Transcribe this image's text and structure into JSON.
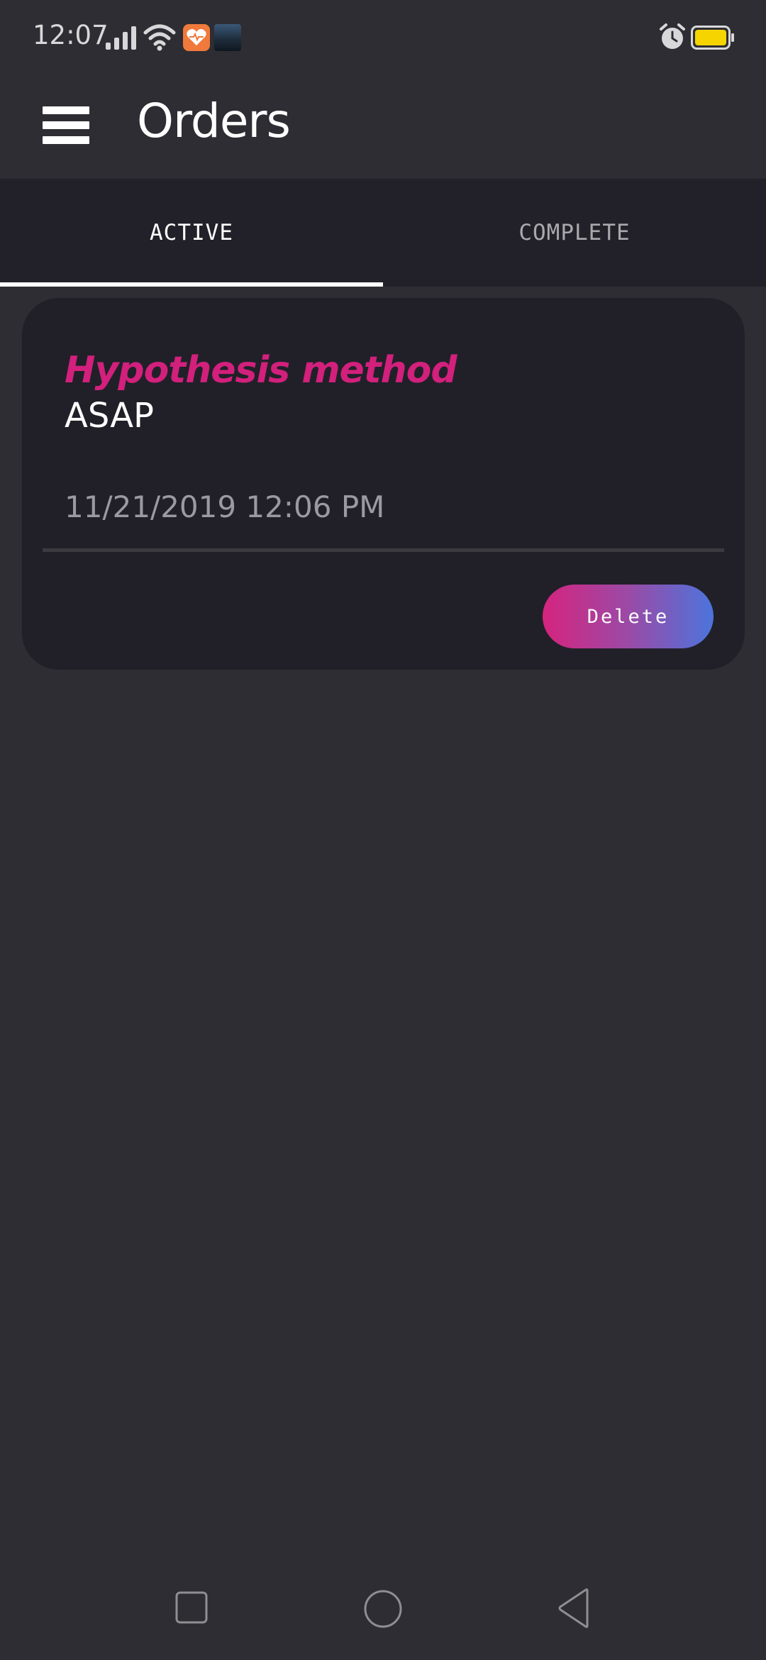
{
  "status_bar": {
    "time": "12:07",
    "icons": [
      "signal-icon",
      "wifi-icon",
      "health-app-icon",
      "photo-app-icon",
      "alarm-icon",
      "battery-icon"
    ],
    "battery_color": "#f5d400"
  },
  "app_bar": {
    "title": "Orders",
    "menu_icon": "hamburger-menu-icon"
  },
  "tabs": [
    {
      "label": "ACTIVE",
      "selected": true
    },
    {
      "label": "COMPLETE",
      "selected": false
    }
  ],
  "orders": [
    {
      "name": "Hypothesis method",
      "timing": "ASAP",
      "datetime": "11/21/2019 12:06 PM",
      "delete_label": "Delete"
    }
  ],
  "colors": {
    "background": "#2e2d33",
    "card": "#212029",
    "accent_pink": "#d2207c",
    "accent_blue": "#4c74dc"
  },
  "nav_bar": {
    "icons": [
      "recents-square-icon",
      "home-circle-icon",
      "back-triangle-icon"
    ]
  }
}
